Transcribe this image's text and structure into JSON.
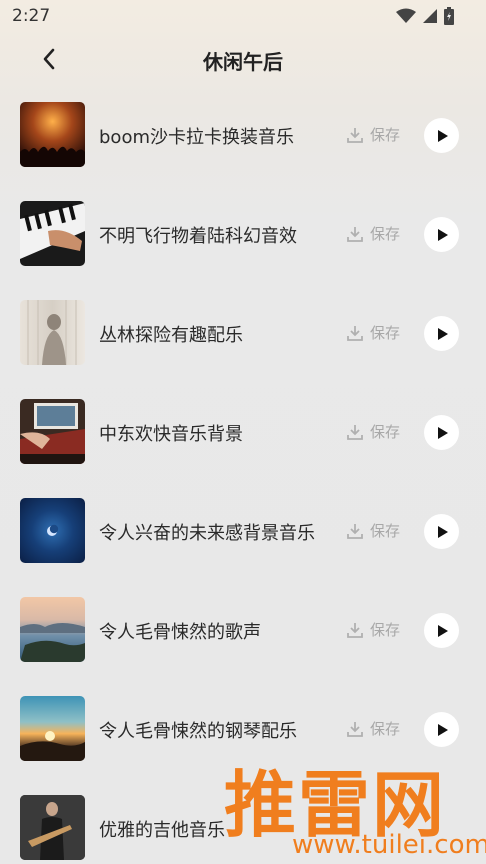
{
  "status": {
    "time": "2:27",
    "wifi_icon": "wifi-icon",
    "signal_icon": "signal-icon",
    "battery_icon": "battery-icon"
  },
  "header": {
    "title": "休闲午后",
    "back_icon": "chevron-left-icon"
  },
  "save_label": "保存",
  "items": [
    {
      "title": "boom沙卡拉卡换装音乐"
    },
    {
      "title": "不明飞行物着陆科幻音效"
    },
    {
      "title": "丛林探险有趣配乐"
    },
    {
      "title": "中东欢快音乐背景"
    },
    {
      "title": "令人兴奋的未来感背景音乐"
    },
    {
      "title": "令人毛骨悚然的歌声"
    },
    {
      "title": "令人毛骨悚然的钢琴配乐"
    },
    {
      "title": "优雅的吉他音乐"
    }
  ],
  "watermark": {
    "main": "推雷网",
    "url": "www.tuilei.com"
  },
  "colors": {
    "accent_watermark": "#f07e1e",
    "play_bg": "#ffffff",
    "save_text": "#a8a8a8"
  }
}
